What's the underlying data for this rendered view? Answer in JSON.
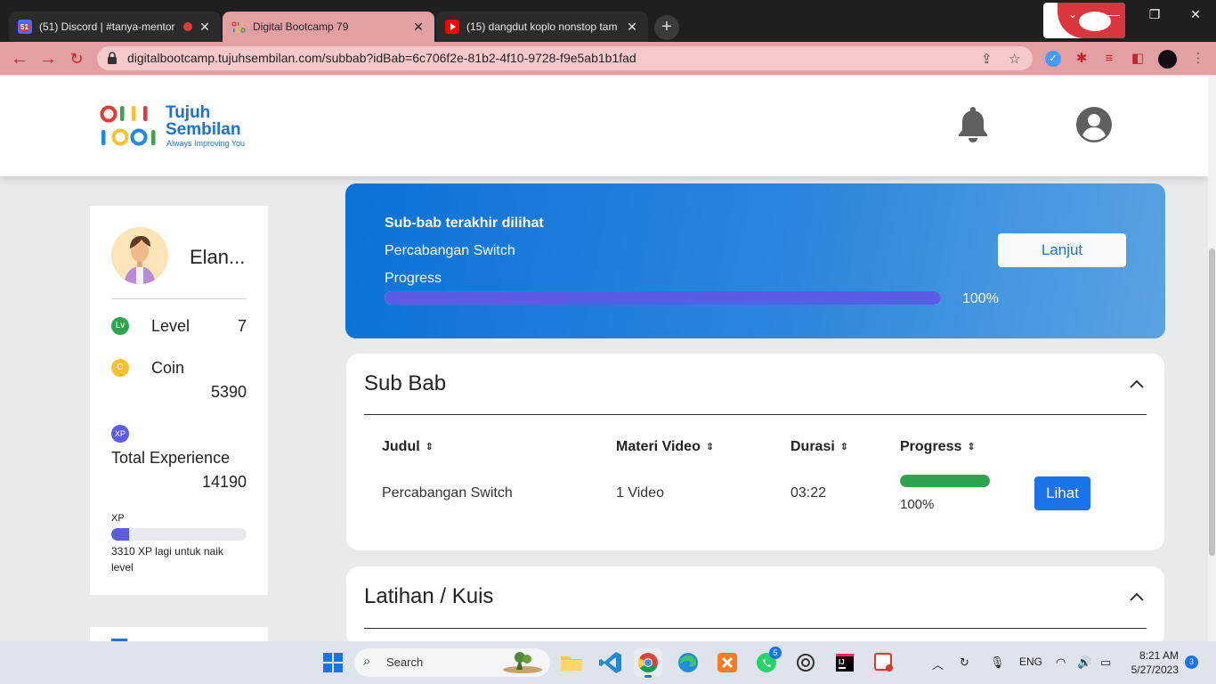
{
  "browser": {
    "tabs": [
      {
        "title": "(51) Discord | #tanya-mentor",
        "close": "✕"
      },
      {
        "title": "Digital Bootcamp 79",
        "close": "✕"
      },
      {
        "title": "(15) dangdut koplo nonstop tam",
        "close": "✕"
      }
    ],
    "new_tab": "+",
    "window_controls": {
      "minimize": "—",
      "restore": "❐",
      "close": "✕"
    },
    "url": "digitalbootcamp.tujuhsembilan.com/subbab?idBab=6c706f2e-81b2-4f10-9728-f9e5ab1b1fad",
    "discord_badge": "51"
  },
  "header": {
    "logo_line1": "Tujuh",
    "logo_line2": "Sembilan",
    "logo_tagline": "Always Improving You"
  },
  "profile": {
    "name": "Elan...",
    "level_badge": "Lv",
    "level_label": "Level",
    "level_value": "7",
    "coin_badge": "C",
    "coin_label": "Coin",
    "coin_value": "5390",
    "xp_badge": "XP",
    "xp_total_label": "Total Experience",
    "xp_total_value": "14190",
    "xp_bar_label": "XP",
    "xp_bar_fraction": 0.13,
    "xp_remaining_text": "3310 XP lagi untuk naik level"
  },
  "last_viewed": {
    "heading": "Sub-bab terakhir dilihat",
    "subchapter": "Percabangan Switch",
    "progress_label": "Progress",
    "progress_fraction": 1.0,
    "progress_text": "100%",
    "continue_button": "Lanjut"
  },
  "subbab_section": {
    "title": "Sub Bab",
    "columns": [
      "Judul",
      "Materi Video",
      "Durasi",
      "Progress"
    ],
    "sort_glyph": "⇕",
    "rows": [
      {
        "judul": "Percabangan Switch",
        "materi_video": "1 Video",
        "durasi": "03:22",
        "progress_fraction": 1.0,
        "progress_text": "100%",
        "action": "Lihat"
      }
    ]
  },
  "kuis_section": {
    "title": "Latihan / Kuis"
  },
  "taskbar": {
    "search_placeholder": "Search",
    "whatsapp_badge": "5",
    "language": "ENG",
    "time": "8:21 AM",
    "date": "5/27/2023",
    "notification_count": "3"
  },
  "colors": {
    "browser_accent": "#e3a0a4",
    "brand_blue": "#1f6fd1",
    "primary_button": "#1a73e8",
    "progress_purple": "#5b5be6",
    "progress_green": "#2ea44f"
  }
}
